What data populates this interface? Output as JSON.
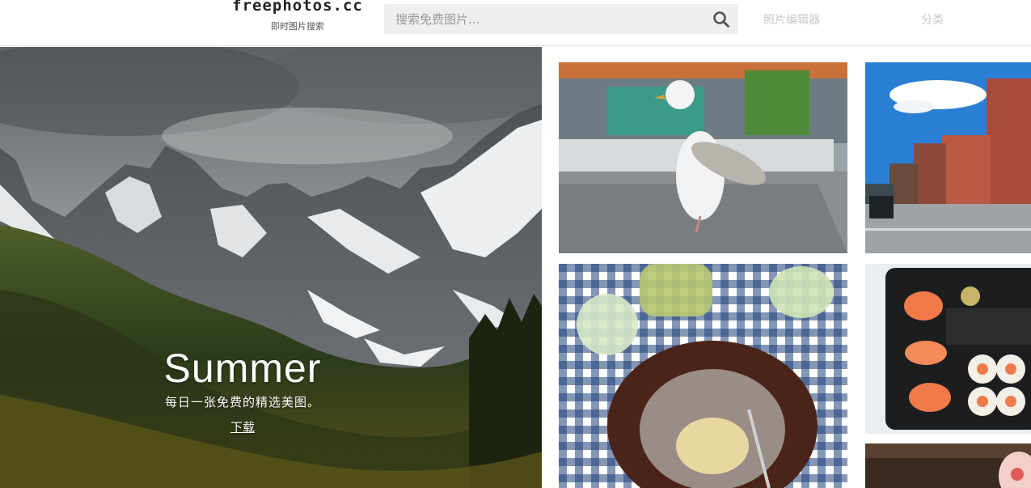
{
  "header": {
    "logo_title": "freephotos.cc",
    "logo_subtitle": "即时图片搜索",
    "search_placeholder": "搜索免费图片...",
    "search_icon": "search-icon",
    "nav": {
      "photo_editor": "照片编辑器",
      "categories": "分类"
    }
  },
  "hero": {
    "title": "Summer",
    "subtitle": "每日一张免费的精选美图。",
    "download_label": "下载"
  },
  "colors": {
    "nav_text": "#c8c8c8",
    "search_bg": "#efefef",
    "hero_text": "#ffffff"
  }
}
